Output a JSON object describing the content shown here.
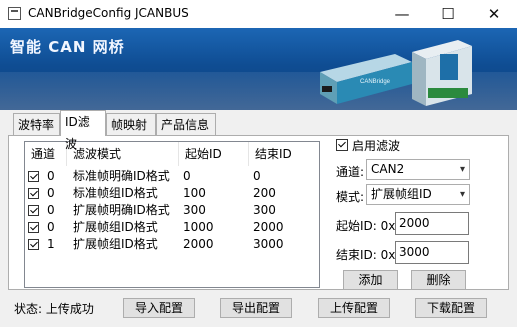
{
  "window": {
    "title": "CANBridgeConfig JCANBUS",
    "minimize": "—",
    "maximize": "☐",
    "close": "✕"
  },
  "banner": {
    "text": "智能 CAN 网桥",
    "device_label": "CANBridge"
  },
  "tabs": [
    {
      "label": "波特率"
    },
    {
      "label": "ID滤波"
    },
    {
      "label": "帧映射"
    },
    {
      "label": "产品信息"
    }
  ],
  "filter_table": {
    "columns": [
      "通道",
      "滤波模式",
      "起始ID",
      "结束ID"
    ],
    "rows": [
      {
        "checked": true,
        "channel": "0",
        "mode": "标准帧明确ID格式",
        "start": "0",
        "end": "0"
      },
      {
        "checked": true,
        "channel": "0",
        "mode": "标准帧组ID格式",
        "start": "100",
        "end": "200"
      },
      {
        "checked": true,
        "channel": "0",
        "mode": "扩展帧明确ID格式",
        "start": "300",
        "end": "300"
      },
      {
        "checked": true,
        "channel": "0",
        "mode": "扩展帧组ID格式",
        "start": "1000",
        "end": "2000"
      },
      {
        "checked": true,
        "channel": "1",
        "mode": "扩展帧组ID格式",
        "start": "2000",
        "end": "3000"
      }
    ]
  },
  "filter_form": {
    "enable_label": "启用滤波",
    "enable_checked": true,
    "channel_label": "通道:",
    "channel_value": "CAN2",
    "mode_label": "模式:",
    "mode_value": "扩展帧组ID",
    "start_label": "起始ID: 0x",
    "start_value": "2000",
    "end_label": "结束ID: 0x",
    "end_value": "3000",
    "add_button": "添加",
    "delete_button": "删除"
  },
  "footer": {
    "status": "状态: 上传成功",
    "import_button": "导入配置",
    "export_button": "导出配置",
    "upload_button": "上传配置",
    "download_button": "下载配置"
  }
}
